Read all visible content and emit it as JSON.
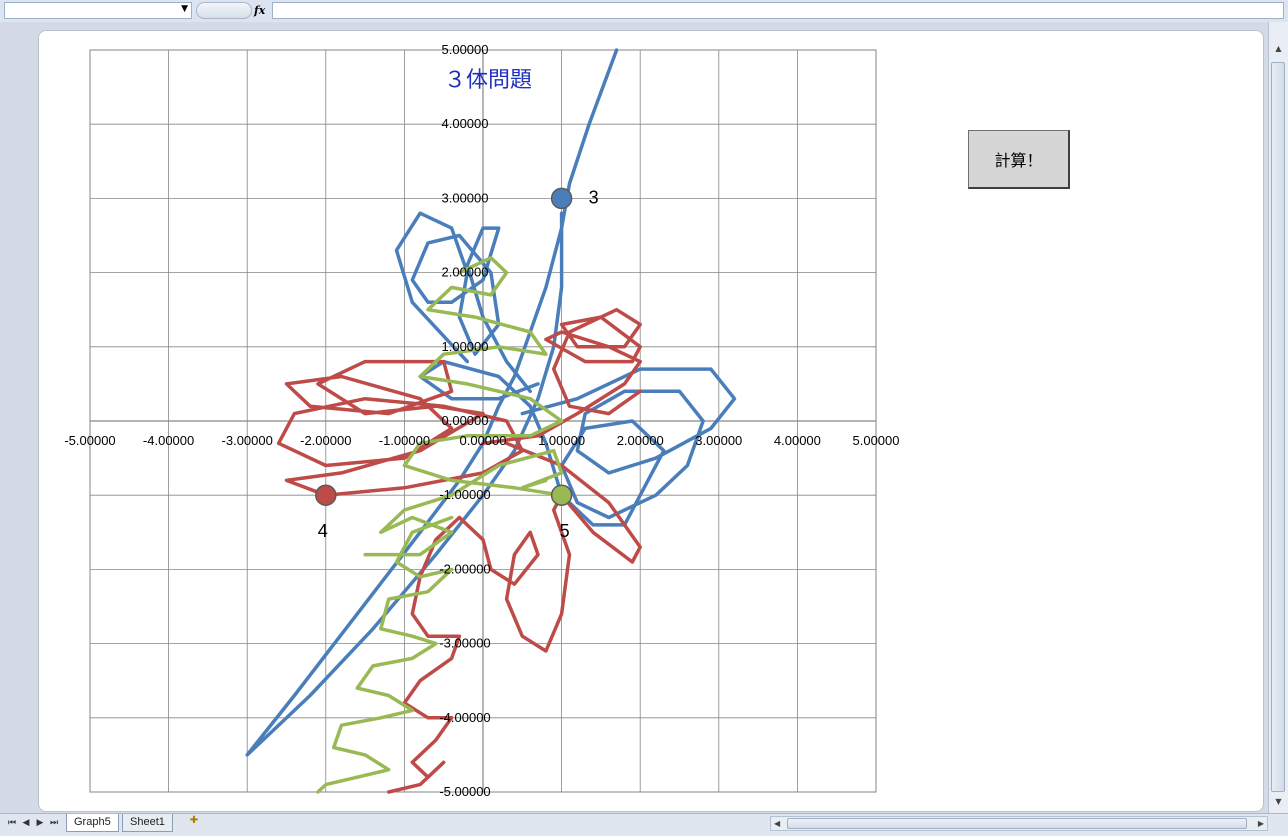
{
  "window": {
    "fx_label": "fx",
    "tabs": [
      {
        "label": "Graph5",
        "active": true
      },
      {
        "label": "Sheet1",
        "active": false
      }
    ]
  },
  "button": {
    "label": "計算！"
  },
  "chart_data": {
    "type": "scatter",
    "title": "３体問題",
    "xlim": [
      -5,
      5
    ],
    "ylim": [
      -5,
      5
    ],
    "x_ticks": [
      "-5.00000",
      "-4.00000",
      "-3.00000",
      "-2.00000",
      "-1.00000",
      "0.00000",
      "1.00000",
      "2.00000",
      "3.00000",
      "4.00000",
      "5.00000"
    ],
    "y_ticks": [
      "-5.00000",
      "-4.00000",
      "-3.00000",
      "-2.00000",
      "-1.00000",
      "0.00000",
      "1.00000",
      "2.00000",
      "3.00000",
      "4.00000",
      "5.00000"
    ],
    "grid": true,
    "colors": {
      "blue": "#4a7ebb",
      "red": "#be4b48",
      "green": "#98b954"
    },
    "bodies": [
      {
        "label": "3",
        "x": 1,
        "y": 3,
        "color": "#4a7ebb"
      },
      {
        "label": "4",
        "x": -2,
        "y": -1,
        "color": "#be4b48"
      },
      {
        "label": "5",
        "x": 1,
        "y": -1,
        "color": "#98b954"
      }
    ],
    "trajectories": [
      {
        "color": "#4a7ebb",
        "points": [
          [
            1.7,
            5
          ],
          [
            1.35,
            4
          ],
          [
            1.1,
            3.2
          ],
          [
            1,
            2.6
          ],
          [
            0.8,
            1.8
          ],
          [
            0.6,
            1.2
          ],
          [
            0.4,
            0.6
          ],
          [
            0.2,
            0.2
          ],
          [
            0,
            -0.3
          ],
          [
            -0.3,
            -0.8
          ],
          [
            -0.8,
            -1.5
          ],
          [
            -1.6,
            -2.6
          ],
          [
            -2.4,
            -3.7
          ],
          [
            -3,
            -4.5
          ],
          [
            -2.8,
            -4.3
          ],
          [
            -2.2,
            -3.7
          ],
          [
            -1.4,
            -2.8
          ],
          [
            -0.6,
            -1.8
          ],
          [
            0,
            -1
          ],
          [
            0.4,
            -0.4
          ],
          [
            0.7,
            0.3
          ],
          [
            0.9,
            1
          ],
          [
            1,
            1.8
          ],
          [
            1,
            2.8
          ]
        ]
      },
      {
        "color": "#4a7ebb",
        "points": [
          [
            -0.2,
            0.8
          ],
          [
            -0.9,
            1.6
          ],
          [
            -1.1,
            2.3
          ],
          [
            -0.8,
            2.8
          ],
          [
            -0.4,
            2.6
          ],
          [
            -0.2,
            2
          ],
          [
            -0.3,
            1.4
          ],
          [
            -0.1,
            0.9
          ],
          [
            0.2,
            1.3
          ],
          [
            0.1,
            2
          ],
          [
            -0.3,
            2.5
          ],
          [
            -0.7,
            2.4
          ],
          [
            -0.9,
            1.9
          ],
          [
            -0.7,
            1.6
          ],
          [
            -0.4,
            1.6
          ],
          [
            0,
            1.9
          ],
          [
            0.2,
            2.6
          ],
          [
            0,
            2.6
          ],
          [
            -0.2,
            2.1
          ],
          [
            0,
            1.4
          ],
          [
            0.3,
            0.8
          ],
          [
            0.6,
            0.4
          ]
        ]
      },
      {
        "color": "#4a7ebb",
        "points": [
          [
            0.5,
            0.1
          ],
          [
            1.2,
            0.3
          ],
          [
            2,
            0.7
          ],
          [
            2.9,
            0.7
          ],
          [
            3.2,
            0.3
          ],
          [
            2.9,
            -0.1
          ],
          [
            2.2,
            -0.5
          ],
          [
            1.6,
            -0.7
          ],
          [
            1.2,
            -0.4
          ],
          [
            1.3,
            0.1
          ],
          [
            1.8,
            0.4
          ],
          [
            2.5,
            0.4
          ],
          [
            2.8,
            0
          ],
          [
            2.6,
            -0.6
          ],
          [
            2.2,
            -1
          ],
          [
            1.6,
            -1.3
          ],
          [
            1.2,
            -1.1
          ],
          [
            1,
            -0.6
          ],
          [
            1.3,
            -0.1
          ],
          [
            1.9,
            0
          ],
          [
            2.3,
            -0.4
          ],
          [
            2,
            -1
          ],
          [
            1.8,
            -1.4
          ],
          [
            1.4,
            -1.4
          ],
          [
            1,
            -1
          ],
          [
            0.8,
            -0.3
          ],
          [
            0.6,
            0.2
          ],
          [
            0.2,
            0.6
          ],
          [
            -0.5,
            0.8
          ],
          [
            -0.8,
            0.6
          ],
          [
            -0.4,
            0.3
          ],
          [
            0.2,
            0.3
          ],
          [
            0.7,
            0.5
          ]
        ]
      },
      {
        "color": "#be4b48",
        "points": [
          [
            -2,
            -1
          ],
          [
            -1,
            -0.9
          ],
          [
            0,
            -0.7
          ],
          [
            0.5,
            -0.4
          ],
          [
            0.3,
            0
          ],
          [
            -0.5,
            0.2
          ],
          [
            -1.5,
            0.3
          ],
          [
            -2.4,
            0.1
          ],
          [
            -2.6,
            -0.3
          ],
          [
            -2,
            -0.6
          ],
          [
            -1,
            -0.5
          ],
          [
            -0.4,
            -0.1
          ],
          [
            -0.8,
            0.3
          ],
          [
            -1.8,
            0.6
          ],
          [
            -2.5,
            0.5
          ],
          [
            -2.2,
            0.2
          ],
          [
            -1.2,
            0.1
          ],
          [
            -0.4,
            0.4
          ],
          [
            -0.5,
            0.8
          ],
          [
            -1.5,
            0.8
          ],
          [
            -2.1,
            0.5
          ],
          [
            -1.5,
            0.1
          ],
          [
            -0.6,
            0.2
          ],
          [
            0,
            0.1
          ],
          [
            -0.8,
            -0.4
          ],
          [
            -1.8,
            -0.7
          ],
          [
            -2.5,
            -0.8
          ],
          [
            -2,
            -1
          ]
        ]
      },
      {
        "color": "#be4b48",
        "points": [
          [
            0,
            -0.3
          ],
          [
            0.7,
            -0.2
          ],
          [
            1.2,
            0.1
          ],
          [
            1.8,
            0.5
          ],
          [
            2,
            0.8
          ],
          [
            1.6,
            1
          ],
          [
            1,
            1.2
          ],
          [
            0.8,
            1.1
          ],
          [
            1.3,
            0.8
          ],
          [
            1.9,
            0.8
          ],
          [
            2,
            1
          ],
          [
            1.5,
            1.4
          ],
          [
            1,
            1.3
          ],
          [
            1.2,
            1
          ],
          [
            1.8,
            1
          ],
          [
            2,
            1.3
          ],
          [
            1.7,
            1.5
          ],
          [
            1.1,
            1.2
          ],
          [
            0.9,
            0.7
          ],
          [
            1.1,
            0.2
          ],
          [
            1.6,
            0.1
          ],
          [
            2,
            0.4
          ]
        ]
      },
      {
        "color": "#be4b48",
        "points": [
          [
            0.3,
            -0.3
          ],
          [
            1,
            -0.6
          ],
          [
            1.6,
            -1.1
          ],
          [
            2,
            -1.7
          ],
          [
            1.9,
            -1.9
          ],
          [
            1.4,
            -1.5
          ],
          [
            1,
            -1
          ],
          [
            0.9,
            -1.2
          ],
          [
            1.1,
            -1.8
          ],
          [
            1,
            -2.6
          ],
          [
            0.8,
            -3.1
          ],
          [
            0.5,
            -2.9
          ],
          [
            0.3,
            -2.4
          ],
          [
            0.4,
            -1.8
          ],
          [
            0.6,
            -1.5
          ],
          [
            0.7,
            -1.8
          ],
          [
            0.4,
            -2.2
          ],
          [
            0.1,
            -2
          ],
          [
            0,
            -1.6
          ],
          [
            -0.3,
            -1.3
          ],
          [
            -0.6,
            -1.6
          ],
          [
            -0.8,
            -2.1
          ],
          [
            -0.9,
            -2.6
          ],
          [
            -0.7,
            -2.9
          ],
          [
            -0.3,
            -2.9
          ],
          [
            -0.4,
            -3.2
          ],
          [
            -0.8,
            -3.5
          ],
          [
            -1,
            -3.8
          ],
          [
            -0.7,
            -4
          ],
          [
            -0.4,
            -4
          ],
          [
            -0.6,
            -4.3
          ],
          [
            -0.9,
            -4.6
          ],
          [
            -0.7,
            -4.8
          ],
          [
            -0.5,
            -4.6
          ],
          [
            -0.8,
            -4.9
          ],
          [
            -1.2,
            -5
          ]
        ]
      },
      {
        "color": "#98b954",
        "points": [
          [
            1,
            -1
          ],
          [
            0.4,
            -0.9
          ],
          [
            -0.4,
            -0.8
          ],
          [
            -1,
            -0.6
          ],
          [
            -0.8,
            -0.3
          ],
          [
            -0.2,
            -0.2
          ],
          [
            0.6,
            -0.2
          ],
          [
            1,
            0
          ],
          [
            0.6,
            0.3
          ],
          [
            -0.2,
            0.5
          ],
          [
            -0.8,
            0.6
          ],
          [
            -0.5,
            0.9
          ],
          [
            0.2,
            1
          ],
          [
            0.8,
            0.9
          ],
          [
            0.6,
            1.2
          ],
          [
            -0.1,
            1.4
          ],
          [
            -0.7,
            1.5
          ],
          [
            -0.4,
            1.8
          ],
          [
            0.1,
            1.7
          ],
          [
            0.3,
            2
          ],
          [
            0.1,
            2.2
          ],
          [
            -0.3,
            2
          ]
        ]
      },
      {
        "color": "#98b954",
        "points": [
          [
            -0.4,
            -1.3
          ],
          [
            -0.9,
            -1.5
          ],
          [
            -1.1,
            -1.9
          ],
          [
            -0.8,
            -2.1
          ],
          [
            -0.4,
            -2
          ],
          [
            -0.7,
            -2.3
          ],
          [
            -1.2,
            -2.4
          ],
          [
            -1.3,
            -2.8
          ],
          [
            -0.9,
            -2.9
          ],
          [
            -0.6,
            -3
          ],
          [
            -0.9,
            -3.2
          ],
          [
            -1.4,
            -3.3
          ],
          [
            -1.6,
            -3.6
          ],
          [
            -1.2,
            -3.7
          ],
          [
            -0.9,
            -3.9
          ],
          [
            -1.3,
            -4
          ],
          [
            -1.8,
            -4.1
          ],
          [
            -1.9,
            -4.4
          ],
          [
            -1.5,
            -4.5
          ],
          [
            -1.2,
            -4.7
          ],
          [
            -1.6,
            -4.8
          ],
          [
            -2,
            -4.9
          ],
          [
            -2.1,
            -5
          ]
        ]
      },
      {
        "color": "#98b954",
        "points": [
          [
            -1.5,
            -1.8
          ],
          [
            -0.8,
            -1.8
          ],
          [
            -0.4,
            -1.5
          ],
          [
            -0.9,
            -1.3
          ],
          [
            -1.3,
            -1.5
          ],
          [
            -1,
            -1.2
          ],
          [
            -0.4,
            -1
          ],
          [
            0.2,
            -0.6
          ],
          [
            0.9,
            -0.4
          ],
          [
            1,
            -0.7
          ],
          [
            0.5,
            -0.9
          ],
          [
            0.8,
            -0.8
          ]
        ]
      }
    ]
  }
}
